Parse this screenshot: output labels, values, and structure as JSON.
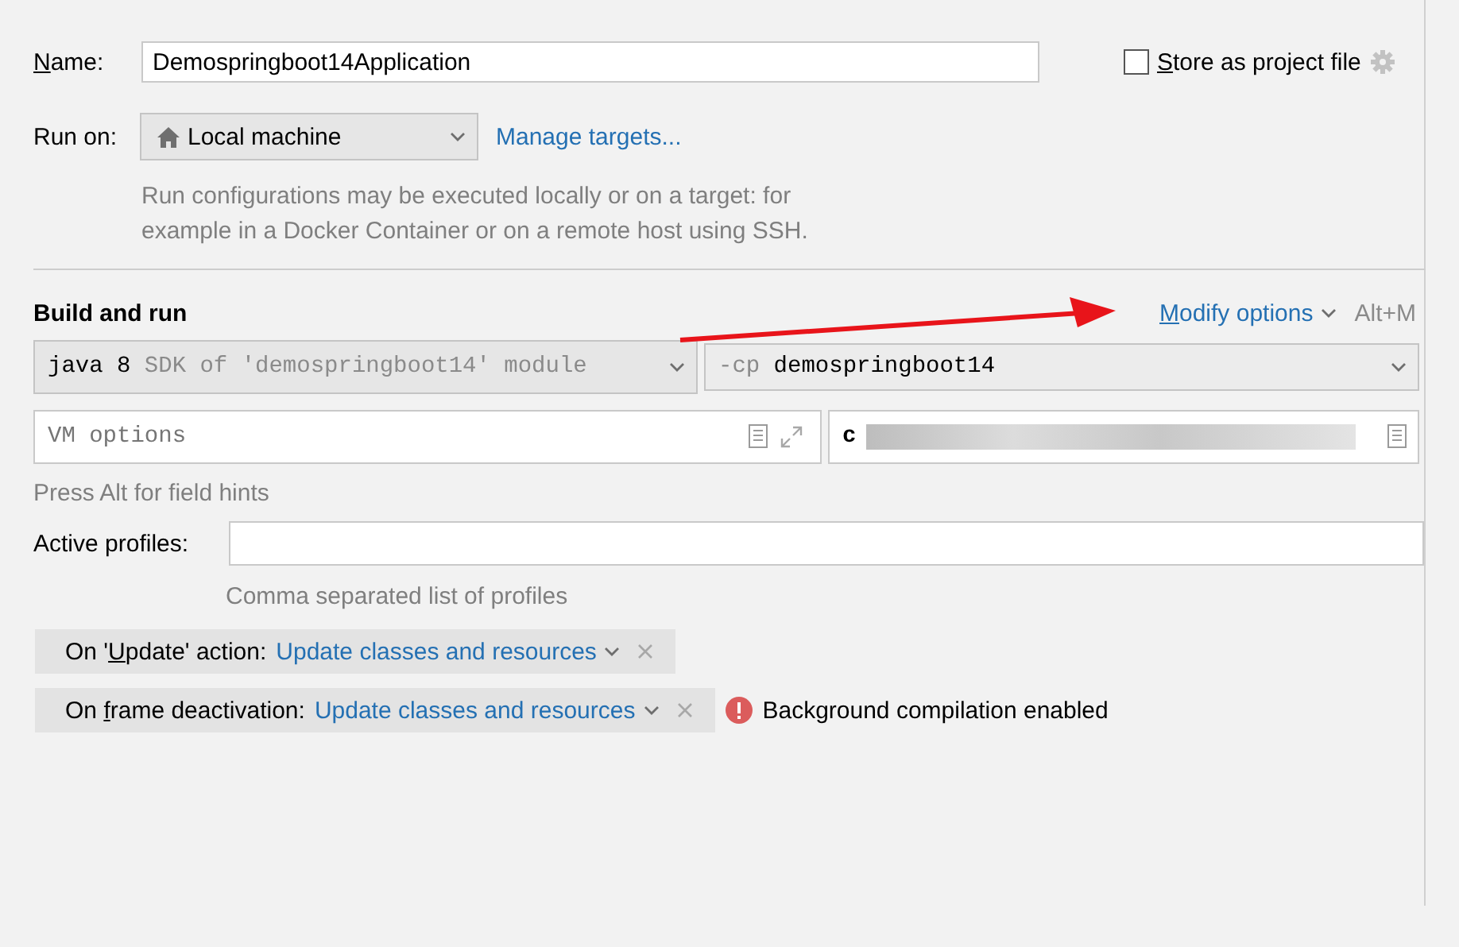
{
  "name_field": {
    "label_key": "N",
    "label_end": "ame:",
    "value": "Demospringboot14Application"
  },
  "store_option": {
    "label_key": "S",
    "label_end": "tore as project file",
    "checked": false
  },
  "run_on": {
    "label": "Run on:",
    "target": "Local machine",
    "link": "Manage targets...",
    "hint": "Run configurations may be executed locally or on a target: for example in a Docker Container or on a remote host using SSH."
  },
  "build_and_run": {
    "title": "Build and run",
    "modify_key": "M",
    "modify_end": "odify options",
    "shortcut": "Alt+M",
    "jdk": {
      "version": "java 8",
      "detail": "SDK of 'demospringboot14' module"
    },
    "classpath": {
      "flag": "-cp",
      "module": "demospringboot14"
    },
    "vm_options": {
      "placeholder": "VM options"
    },
    "main_class": {
      "value": "c",
      "redacted": true
    },
    "field_hint": "Press Alt for field hints"
  },
  "active_profiles": {
    "label": "Active profiles:",
    "value_hint": "Comma separated list of profiles"
  },
  "actions": [
    {
      "label_start": "On '",
      "label_key": "U",
      "label_end": "pdate' action:",
      "value": "Update classes and resources"
    },
    {
      "label_start": "On ",
      "label_key": "f",
      "label_end": "rame deactivation:",
      "value": "Update classes and resources",
      "warning": "Background compilation enabled"
    }
  ],
  "annotation": {
    "kind": "arrow",
    "color": "#e8141a"
  }
}
